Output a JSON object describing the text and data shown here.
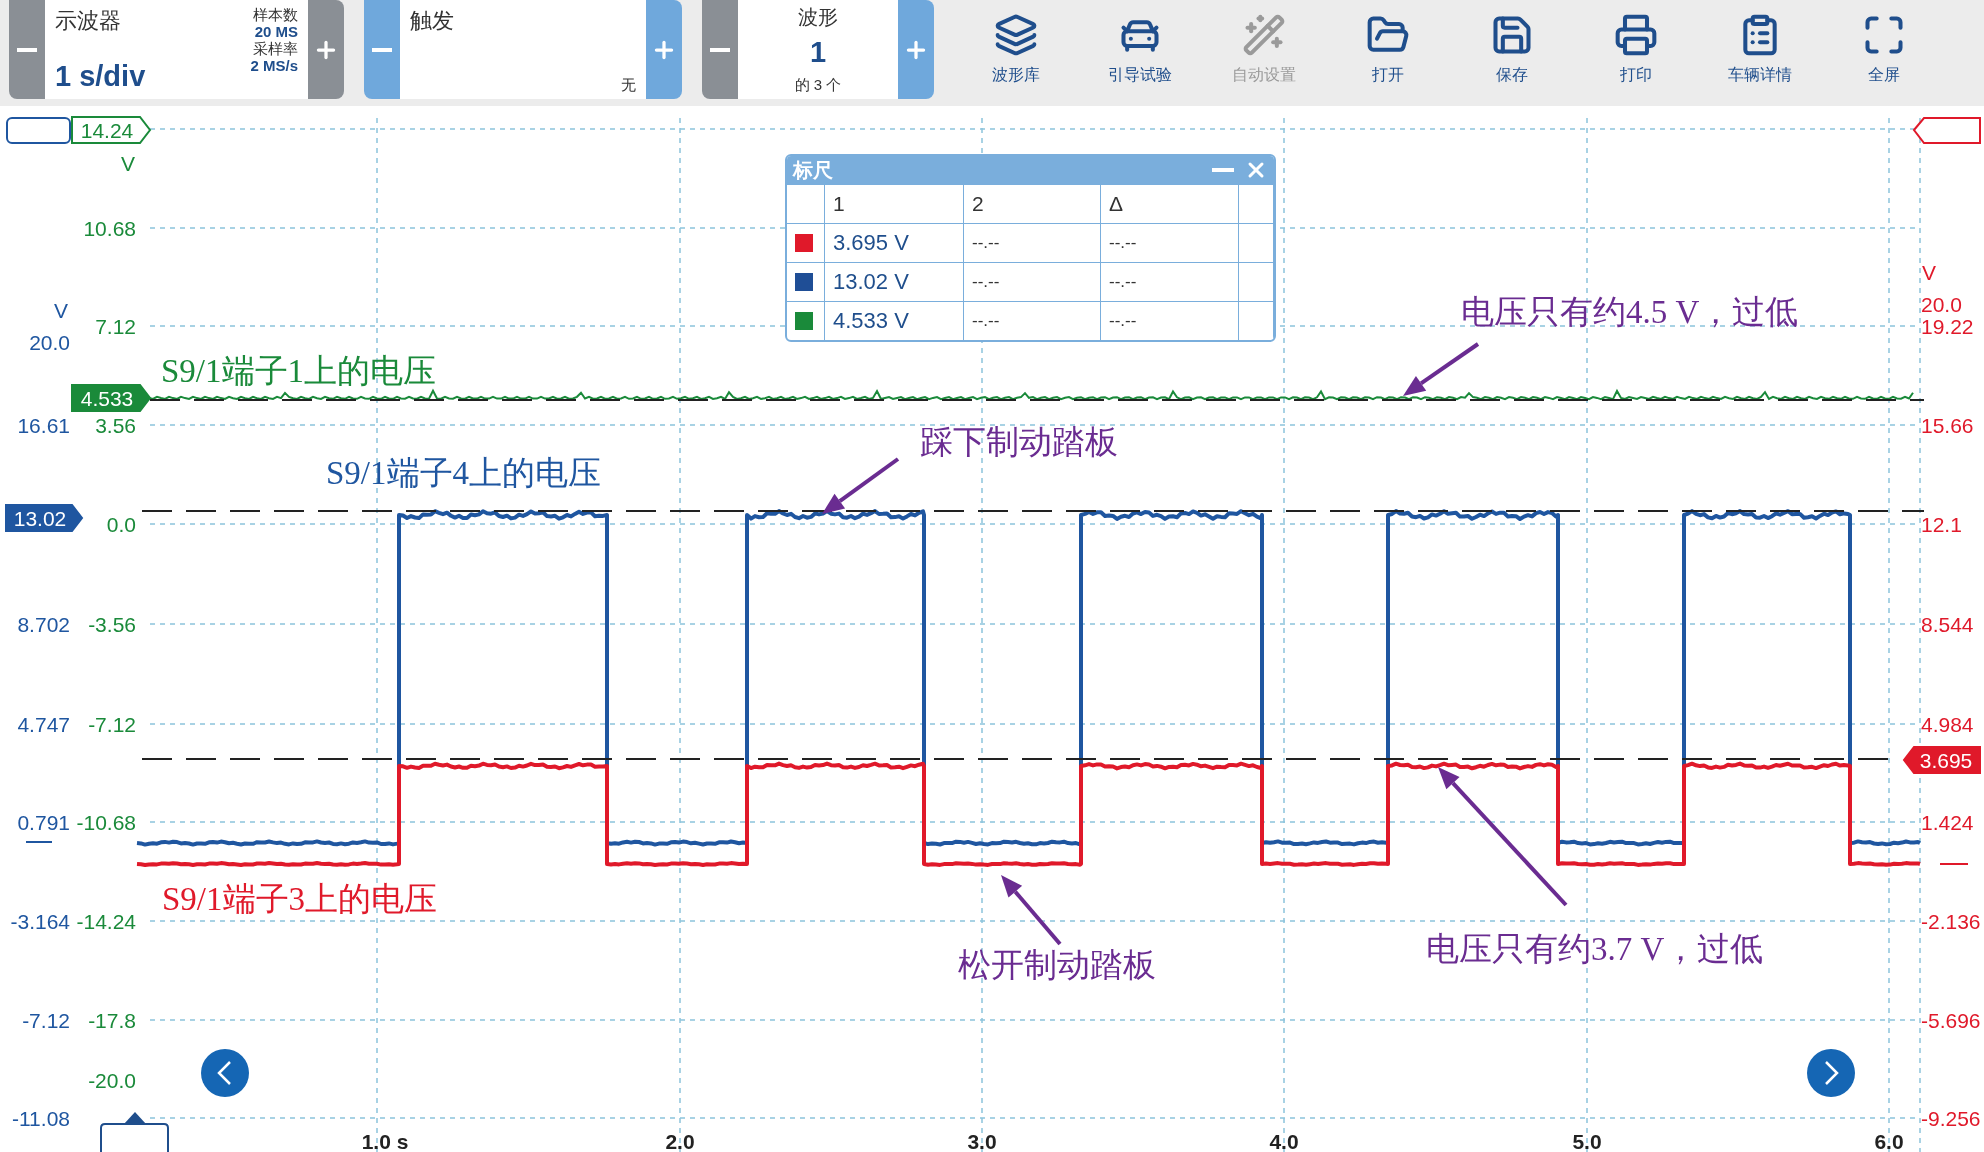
{
  "toolbar": {
    "timebase": {
      "title": "示波器",
      "value": "1 s/div",
      "samples_label": "样本数",
      "samples": "20 MS",
      "rate_label": "采样率",
      "rate": "2 MS/s"
    },
    "trigger": {
      "title": "触发",
      "mode": "无"
    },
    "waveform": {
      "title": "波形",
      "index": "1",
      "count": "的 3 个"
    },
    "buttons": [
      {
        "label": "波形库",
        "disabled": false
      },
      {
        "label": "引导试验",
        "disabled": false
      },
      {
        "label": "自动设置",
        "disabled": true
      },
      {
        "label": "打开",
        "disabled": false
      },
      {
        "label": "保存",
        "disabled": false
      },
      {
        "label": "打印",
        "disabled": false
      },
      {
        "label": "车辆详情",
        "disabled": false
      },
      {
        "label": "全屏",
        "disabled": false
      }
    ]
  },
  "axes": [
    {
      "color": "#1f56a0",
      "unit": "V",
      "marker": "13.02",
      "ticks": [
        "20.0",
        "16.61",
        "8.702",
        "4.747",
        "0.791",
        "-3.164",
        "-7.12",
        "-11.08"
      ]
    },
    {
      "color": "#1a8a3a",
      "unit": "V",
      "top_marker": "14.24",
      "marker": "4.533",
      "ticks": [
        "10.68",
        "7.12",
        "3.56",
        "0.0",
        "-3.56",
        "-7.12",
        "-10.68",
        "-14.24",
        "-17.8",
        "-20.0"
      ]
    },
    {
      "color": "#e0192a",
      "unit": "V",
      "marker": "3.695",
      "ticks": [
        "20.0",
        "19.22",
        "15.66",
        "12.1",
        "8.544",
        "4.984",
        "1.424",
        "-2.136",
        "-5.696",
        "-9.256"
      ]
    }
  ],
  "time_axis": [
    "1.0 s",
    "2.0",
    "3.0",
    "4.0",
    "5.0",
    "6.0"
  ],
  "annotations": [
    {
      "text": "S9/1端子1上的电压",
      "color": "#1a8a3a"
    },
    {
      "text": "S9/1端子4上的电压",
      "color": "#1f56a0"
    },
    {
      "text": "踩下制动踏板",
      "color": "#6a2c91"
    },
    {
      "text": "电压只有约4.5 V，过低",
      "color": "#6a2c91"
    },
    {
      "text": "S9/1端子3上的电压",
      "color": "#e0192a"
    },
    {
      "text": "松开制动踏板",
      "color": "#6a2c91"
    },
    {
      "text": "电压只有约3.7 V，过低",
      "color": "#6a2c91"
    }
  ],
  "ruler": {
    "title": "标尺",
    "columns": [
      "1",
      "2",
      "Δ"
    ],
    "rows": [
      {
        "color": "#e0192a",
        "values": [
          "3.695 V",
          "--.--",
          "--.--"
        ]
      },
      {
        "color": "#1f4e96",
        "values": [
          "13.02 V",
          "--.--",
          "--.--"
        ]
      },
      {
        "color": "#1a8a3a",
        "values": [
          "4.533 V",
          "--.--",
          "--.--"
        ]
      }
    ]
  }
}
